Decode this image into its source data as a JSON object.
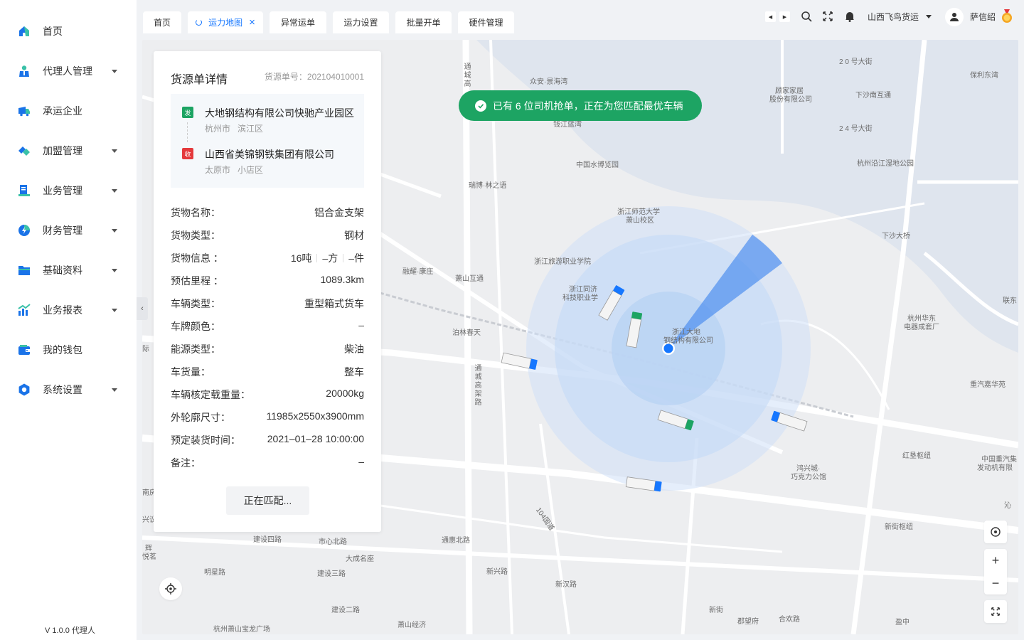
{
  "sidebar": {
    "items": [
      {
        "label": "首页",
        "icon": "home-icon",
        "has_children": false
      },
      {
        "label": "代理人管理",
        "icon": "agent-icon",
        "has_children": true
      },
      {
        "label": "承运企业",
        "icon": "truck-icon",
        "has_children": false
      },
      {
        "label": "加盟管理",
        "icon": "handshake-icon",
        "has_children": true
      },
      {
        "label": "业务管理",
        "icon": "business-icon",
        "has_children": true
      },
      {
        "label": "财务管理",
        "icon": "finance-icon",
        "has_children": true
      },
      {
        "label": "基础资料",
        "icon": "folder-icon",
        "has_children": true
      },
      {
        "label": "业务报表",
        "icon": "report-icon",
        "has_children": true
      },
      {
        "label": "我的钱包",
        "icon": "wallet-icon",
        "has_children": false
      },
      {
        "label": "系统设置",
        "icon": "settings-icon",
        "has_children": true
      }
    ],
    "version": "V 1.0.0 代理人"
  },
  "tabs": [
    {
      "label": "首页",
      "active": false
    },
    {
      "label": "运力地图",
      "active": true
    },
    {
      "label": "异常运单",
      "active": false
    },
    {
      "label": "运力设置",
      "active": false
    },
    {
      "label": "批量开单",
      "active": false
    },
    {
      "label": "硬件管理",
      "active": false
    }
  ],
  "header": {
    "company": "山西飞鸟货运",
    "username": "萨信绍"
  },
  "toast": {
    "text": "已有 6 位司机抢单，正在为您匹配最优车辆"
  },
  "detail": {
    "title": "货源单详情",
    "order_label": "货源单号：",
    "order_no": "202104010001",
    "from": {
      "tag": "发",
      "name": "大地钢结构有限公司快驰产业园区",
      "city": "杭州市",
      "district": "滨江区"
    },
    "to": {
      "tag": "收",
      "name": "山西省美锦钢铁集团有限公司",
      "city": "太原市",
      "district": "小店区"
    },
    "fields": [
      {
        "key": "货物名称：",
        "value": "铝合金支架"
      },
      {
        "key": "货物类型：",
        "value": "钢材"
      },
      {
        "key": "货物信息 ：",
        "value": ""
      },
      {
        "key": "预估里程 ：",
        "value": "1089.3km"
      },
      {
        "key": "车辆类型：",
        "value": "重型箱式货车"
      },
      {
        "key": "车牌颜色：",
        "value": "–"
      },
      {
        "key": "能源类型：",
        "value": "柴油"
      },
      {
        "key": "车货量：",
        "value": "整车"
      },
      {
        "key": "车辆核定载重量：",
        "value": "20000kg"
      },
      {
        "key": "外轮廓尺寸：",
        "value": "11985x2550x3900mm"
      },
      {
        "key": "预定装货时间：",
        "value": "2021–01–28 10:00:00"
      },
      {
        "key": "备注：",
        "value": "–"
      }
    ],
    "cargo_info": {
      "weight": "16吨",
      "volume": "–方",
      "count": "–件"
    },
    "match_button": "正在匹配..."
  },
  "map": {
    "labels": {
      "l1": "众安·景海湾",
      "l2": "钱江蓝湾",
      "l3": "中国水博览园",
      "l4": "瑞博·林之语",
      "l5": "浙江师范大学",
      "l5b": "萧山校区",
      "l6": "浙江旅游职业学院",
      "l7": "浙江同济",
      "l7b": "科技职业学",
      "l8": "萧山互通",
      "l9": "融耀·康庄",
      "l10": "泊林春天",
      "l11": "浙江大地",
      "l11b": "钢结构有限公司",
      "l12": "2 0 号大街",
      "l13": "顾家家居",
      "l13b": "股份有限公司",
      "l14": "下沙南互通",
      "l15": "2 4 号大街",
      "l16": "杭州沿江湿地公园",
      "l17": "保利东湾",
      "l18": "下沙大桥",
      "l19": "杭州华东",
      "l19b": "电器成套厂",
      "l20": "红垦枢纽",
      "l21": "鸿兴城·",
      "l21b": "巧克力公馆",
      "l22": "新街枢纽",
      "l23": "重汽嘉华苑",
      "l24": "中国重汽集",
      "l24b": "发动机有限",
      "l25": "通惠北路",
      "l26": "市心北路",
      "l27": "建设四路",
      "l28": "新兴路",
      "l29": "大成名座",
      "l30": "建设三路",
      "l31": "新汉路",
      "l32": "明星路",
      "l33": "建设二路",
      "l34": "萧山经济",
      "l35": "杭州萧山宝龙广场",
      "l36": "新街",
      "l37": "郡望府",
      "l38": "合欢路",
      "l39": "盈中",
      "l40": "通城高架路",
      "l41": "104国道",
      "l42": "通城高",
      "l43": "联东",
      "l44": "南房",
      "l45": "兴议",
      "l46": "辉",
      "l47": "悦茗",
      "l48": "际",
      "l49": "沁"
    }
  },
  "colors": {
    "accent": "#1677ff",
    "toast": "#1da463",
    "from_tag": "#1da463",
    "to_tag": "#e4393c"
  }
}
